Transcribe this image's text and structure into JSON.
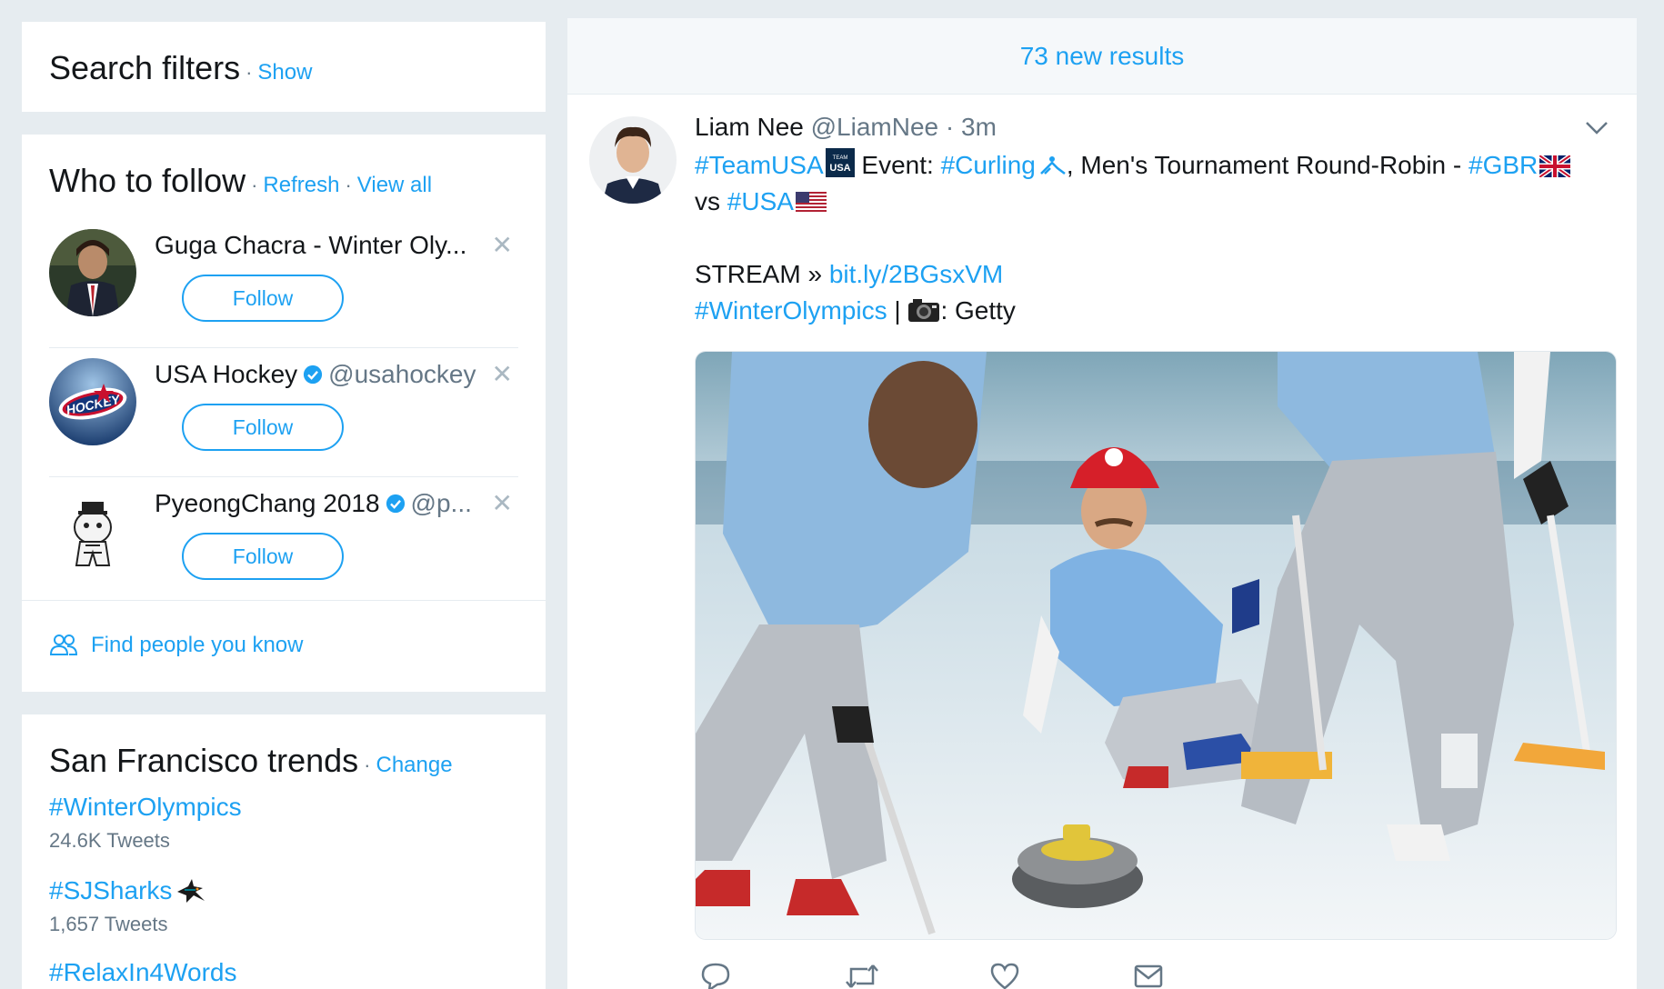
{
  "search_filters": {
    "title": "Search filters",
    "action": "Show"
  },
  "who_to_follow": {
    "title": "Who to follow",
    "refresh": "Refresh",
    "view_all": "View all",
    "items": [
      {
        "name": "Guga Chacra - Winter Oly...",
        "handle": "",
        "verified": false,
        "follow_label": "Follow"
      },
      {
        "name": "USA Hockey",
        "handle": "@usahockey",
        "verified": true,
        "follow_label": "Follow"
      },
      {
        "name": "PyeongChang 2018",
        "handle": "@p...",
        "verified": true,
        "follow_label": "Follow"
      }
    ],
    "find_people": "Find people you know"
  },
  "trends": {
    "title": "San Francisco trends",
    "change": "Change",
    "items": [
      {
        "tag": "#WinterOlympics",
        "count": "24.6K Tweets"
      },
      {
        "tag": "#SJSharks",
        "count": "1,657 Tweets"
      },
      {
        "tag": "#RelaxIn4Words",
        "count": ""
      }
    ]
  },
  "timeline": {
    "new_results": "73 new results",
    "tweet": {
      "name": "Liam Nee",
      "handle": "@LiamNee",
      "time": "· 3m",
      "line1_tag": "#TeamUSA",
      "line1_event": " Event: ",
      "line1_curling": "#Curling",
      "line1_rest": ", Men's Tournament Round-Robin - ",
      "line1_gbr": "#GBR",
      "line2_vs": "vs ",
      "line2_usa": "#USA",
      "stream_label": "STREAM » ",
      "stream_link": "bit.ly/2BGsxVM",
      "credit_tag": "#WinterOlympics",
      "credit_sep": " | ",
      "credit_rest": ": Getty"
    }
  },
  "colors": {
    "accent": "#1da1f2",
    "background": "#e6ecf0",
    "muted": "#657786"
  }
}
